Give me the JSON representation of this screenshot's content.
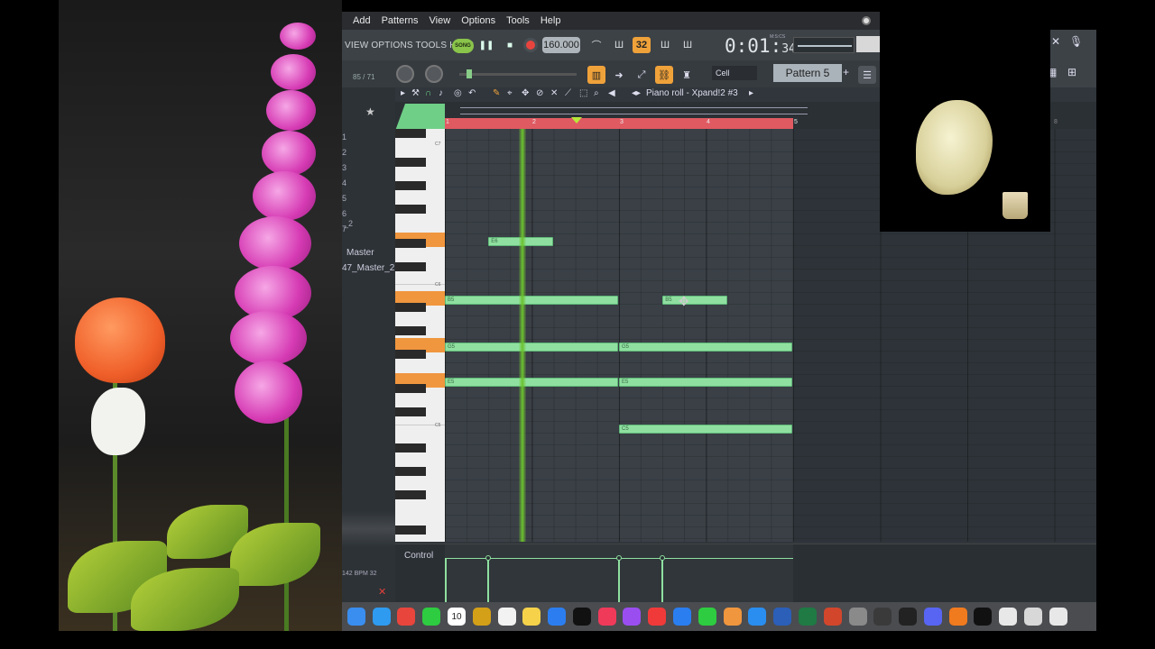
{
  "menubar": {
    "items": [
      "Add",
      "Patterns",
      "View",
      "Options",
      "Tools",
      "Help"
    ]
  },
  "fl": {
    "sub_menu": "VIEW OPTIONS TOOLS HELP",
    "song_label": "SONG",
    "tempo": "160.000",
    "snap_icon_value": "32",
    "time": {
      "main": "0:01:",
      "small": "34",
      "label": "M:S:CS"
    },
    "channel_count": "85 / 71",
    "snap_select": "Cell",
    "pattern_select": "Pattern 5",
    "pattern_add": "+"
  },
  "piano_roll": {
    "title": "Piano roll - Xpand!2 #3",
    "ruler_numbers": [
      "1",
      "2",
      "3",
      "4",
      "5"
    ],
    "far_ruler_number": "8",
    "key_labels": [
      "C7",
      "C6",
      "C5"
    ],
    "notes": [
      {
        "label": "E6",
        "start": 1.5,
        "length": 0.75,
        "pitch_row": "E6"
      },
      {
        "label": "B5",
        "start": 1.0,
        "length": 2.0,
        "pitch_row": "B5"
      },
      {
        "label": "B5",
        "start": 3.5,
        "length": 0.75,
        "pitch_row": "B5"
      },
      {
        "label": "G5",
        "start": 1.0,
        "length": 2.0,
        "pitch_row": "G5"
      },
      {
        "label": "G5",
        "start": 3.0,
        "length": 2.0,
        "pitch_row": "G5"
      },
      {
        "label": "E5",
        "start": 1.0,
        "length": 2.0,
        "pitch_row": "E5"
      },
      {
        "label": "E5",
        "start": 3.0,
        "length": 2.0,
        "pitch_row": "E5"
      },
      {
        "label": "C5",
        "start": 3.0,
        "length": 2.0,
        "pitch_row": "C5"
      }
    ],
    "control_label": "Control"
  },
  "browser": {
    "lines": [
      "1",
      "2",
      "3",
      "4",
      "5",
      "6",
      "7",
      "_2"
    ],
    "master": "Master",
    "master2": "47_Master_2",
    "footer": "142 BPM 32"
  },
  "dock": {
    "icons": [
      "finder-icon",
      "safari-icon",
      "chrome-icon",
      "facetime-icon",
      "calendar-icon",
      "photos-icon",
      "reminders-icon",
      "notes-icon",
      "freeform-icon",
      "tv-icon",
      "music-icon",
      "podcasts-icon",
      "news-icon",
      "keynote-icon",
      "numbers-icon",
      "pages-icon",
      "appstore-icon",
      "word-icon",
      "excel-icon",
      "powerpoint-icon",
      "settings-icon",
      "quicktime-icon",
      "piano-icon",
      "discord-icon",
      "fl-studio-icon",
      "terminal-icon",
      "preview-icon",
      "screenshot-icon",
      "folder-icon"
    ],
    "calendar_day": "10"
  },
  "colors": {
    "note_green": "#8fe0a0",
    "loop_red": "#e05a62",
    "accent_orange": "#f0a23a",
    "playhead_green": "#6cc22e"
  }
}
